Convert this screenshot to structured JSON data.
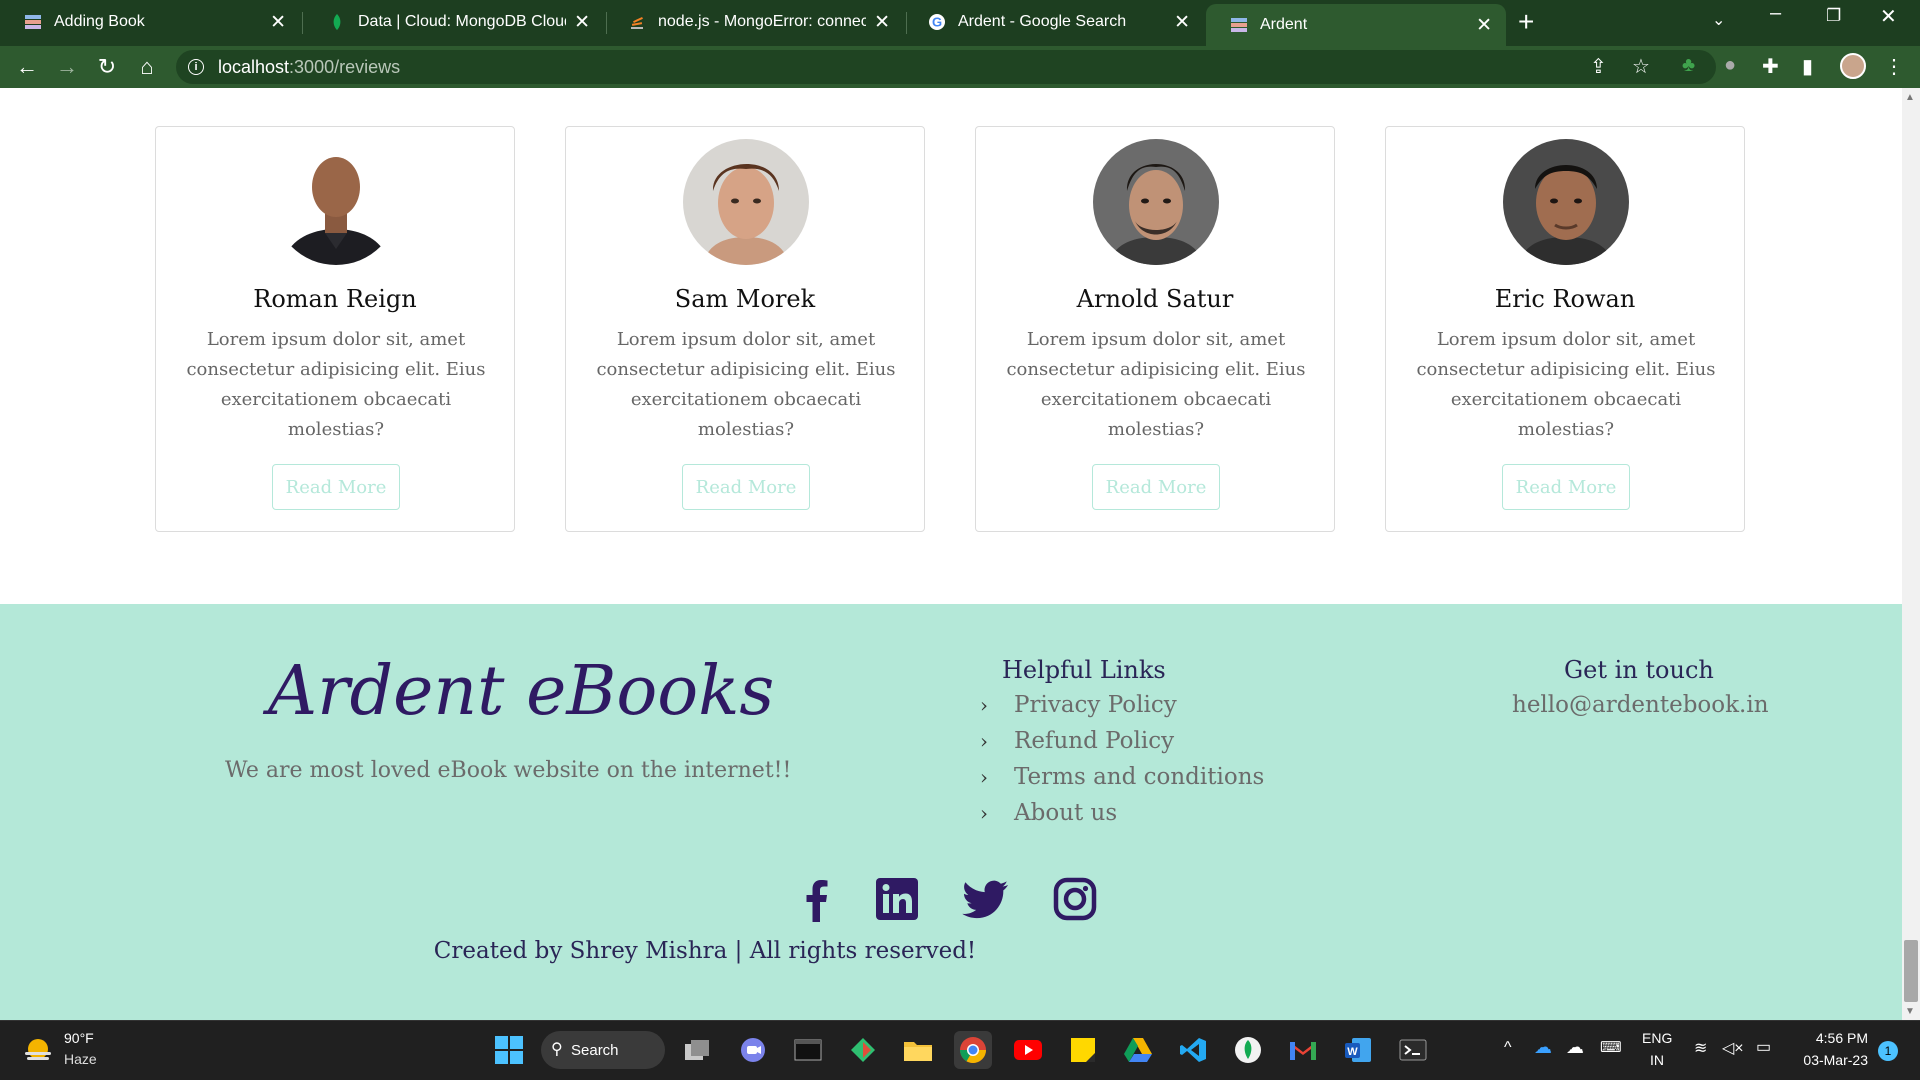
{
  "browser": {
    "tabs": [
      {
        "title": "Adding Book"
      },
      {
        "title": "Data | Cloud: MongoDB Cloud"
      },
      {
        "title": "node.js - MongoError: connect EC"
      },
      {
        "title": "Ardent - Google Search"
      },
      {
        "title": "Ardent"
      }
    ],
    "active_tab": 4,
    "url_host": "localhost",
    "url_path": ":3000/reviews"
  },
  "reviews": [
    {
      "name": "Roman Reign",
      "text": "Lorem ipsum dolor sit, amet consectetur adipisicing elit. Eius exercitationem obcaecati molestias?",
      "button": "Read More"
    },
    {
      "name": "Sam Morek",
      "text": "Lorem ipsum dolor sit, amet consectetur adipisicing elit. Eius exercitationem obcaecati molestias?",
      "button": "Read More"
    },
    {
      "name": "Arnold Satur",
      "text": "Lorem ipsum dolor sit, amet consectetur adipisicing elit. Eius exercitationem obcaecati molestias?",
      "button": "Read More"
    },
    {
      "name": "Eric Rowan",
      "text": "Lorem ipsum dolor sit, amet consectetur adipisicing elit. Eius exercitationem obcaecati molestias?",
      "button": "Read More"
    }
  ],
  "footer": {
    "brand": "Ardent eBooks",
    "tagline": "We are most loved eBook website on the internet!!",
    "links_heading": "Helpful Links",
    "links": [
      "Privacy Policy",
      "Refund Policy",
      "Terms and conditions",
      "About us"
    ],
    "contact_heading": "Get in touch",
    "email": "hello@ardentebook.in",
    "social_icons": [
      "facebook-icon",
      "linkedin-icon",
      "twitter-icon",
      "instagram-icon"
    ],
    "credit": "Created by Shrey Mishra | All rights reserved!"
  },
  "taskbar": {
    "weather_temp": "90°F",
    "weather_cond": "Haze",
    "search_label": "Search",
    "lang_1": "ENG",
    "lang_2": "IN",
    "time": "4:56 PM",
    "date": "03-Mar-23",
    "notification_count": "1"
  },
  "colors": {
    "chrome_frame": "#1d3e20",
    "chrome_toolbar": "#2e5a2f",
    "footer_bg": "#b4e8d8",
    "brand_text": "#2f1a63",
    "button_accent": "#b5e8da"
  }
}
